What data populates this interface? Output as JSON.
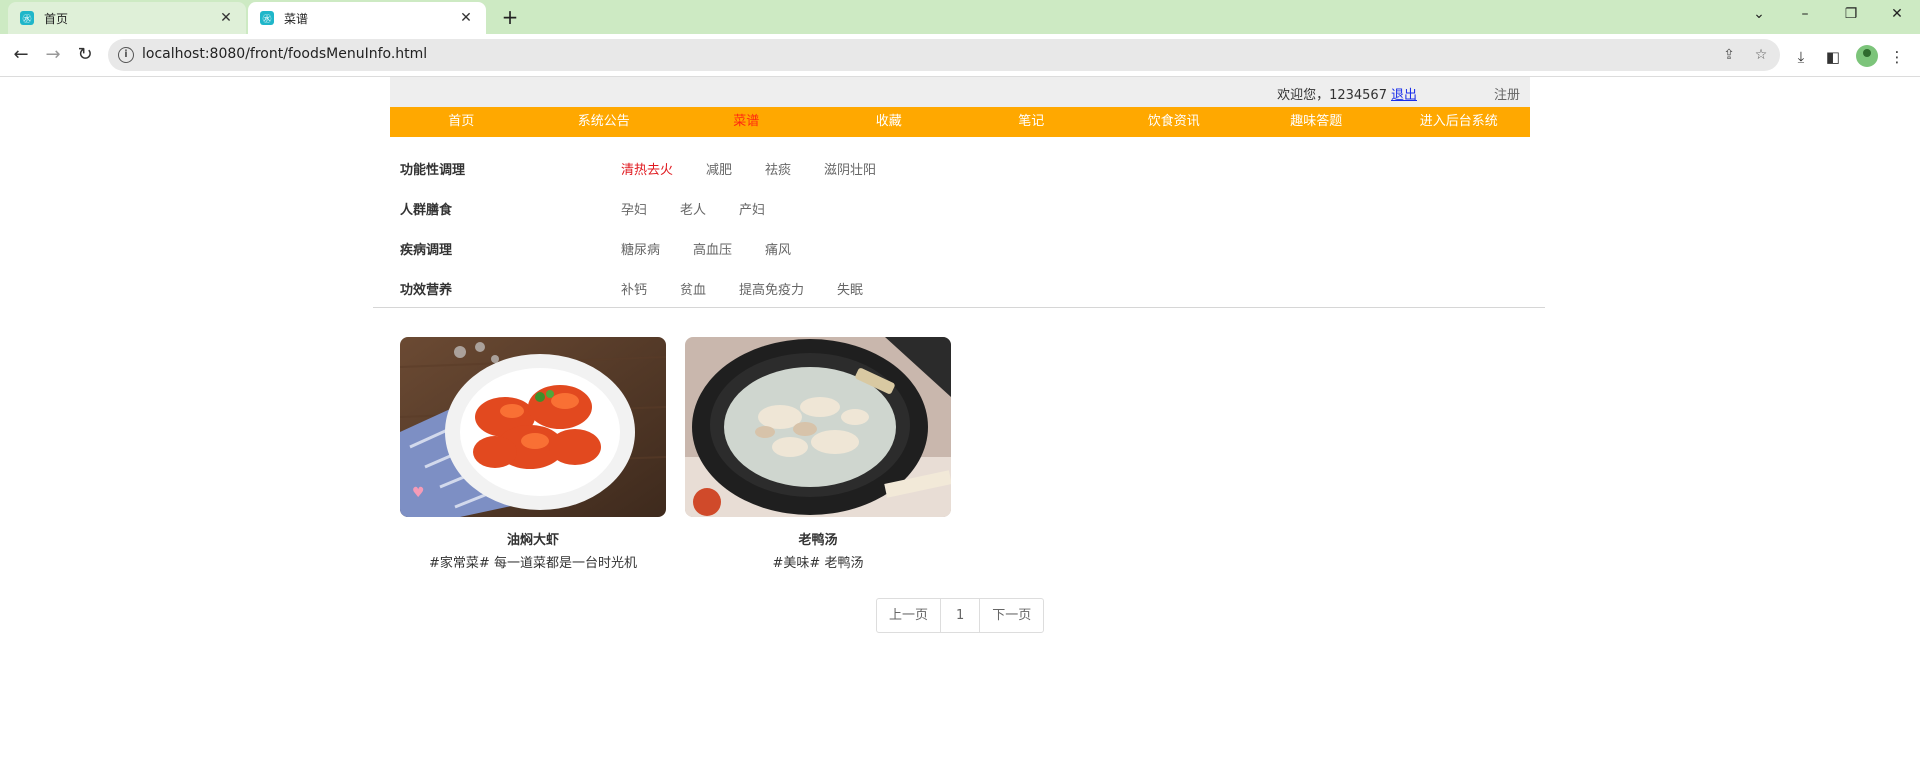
{
  "browser": {
    "tabs": [
      {
        "title": "首页"
      },
      {
        "title": "菜谱"
      }
    ],
    "url": "localhost:8080/front/foodsMenuInfo.html"
  },
  "userbar": {
    "welcome": "欢迎您，1234567",
    "logout": "退出",
    "register": "注册"
  },
  "nav": [
    {
      "label": "首页"
    },
    {
      "label": "系统公告"
    },
    {
      "label": "菜谱"
    },
    {
      "label": "收藏"
    },
    {
      "label": "笔记"
    },
    {
      "label": "饮食资讯"
    },
    {
      "label": "趣味答题"
    },
    {
      "label": "进入后台系统"
    }
  ],
  "filters": [
    {
      "title": "功能性调理",
      "options": [
        "清热去火",
        "减肥",
        "祛痰",
        "滋阴壮阳"
      ]
    },
    {
      "title": "人群膳食",
      "options": [
        "孕妇",
        "老人",
        "产妇"
      ]
    },
    {
      "title": "疾病调理",
      "options": [
        "糖尿病",
        "高血压",
        "痛风"
      ]
    },
    {
      "title": "功效营养",
      "options": [
        "补钙",
        "贫血",
        "提高免疫力",
        "失眠"
      ]
    }
  ],
  "recipes": [
    {
      "name": "油焖大虾",
      "desc": "#家常菜# 每一道菜都是一台时光机"
    },
    {
      "name": "老鸭汤",
      "desc": "#美味# 老鸭汤"
    }
  ],
  "pager": {
    "prev": "上一页",
    "page": "1",
    "next": "下一页"
  },
  "colors": {
    "nav_bg": "#ffa800",
    "nav_active": "#ff2a0f",
    "filter_active": "#e0191f",
    "link": "#1a2eea"
  }
}
